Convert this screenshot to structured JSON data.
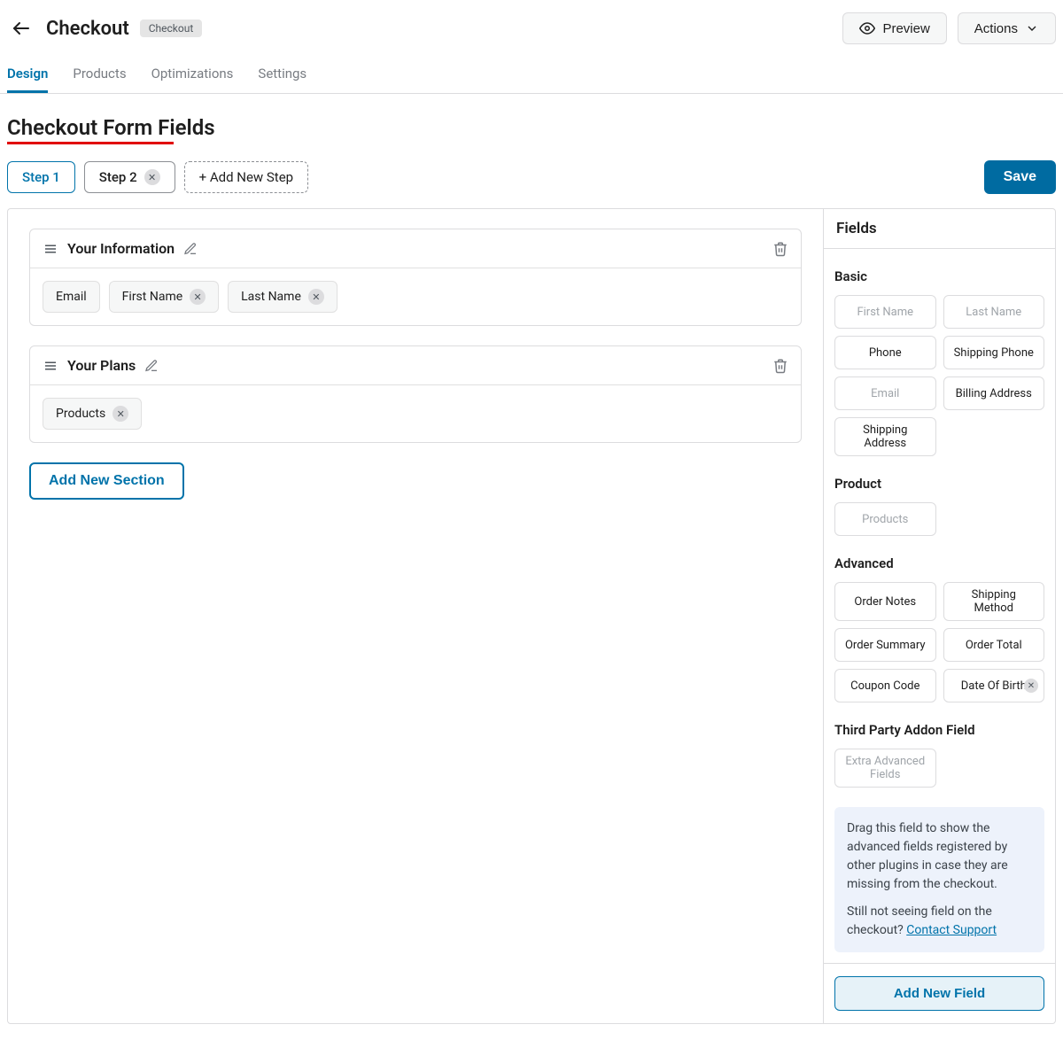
{
  "header": {
    "title": "Checkout",
    "badge": "Checkout",
    "preview": "Preview",
    "actions": "Actions"
  },
  "tabs": [
    "Design",
    "Products",
    "Optimizations",
    "Settings"
  ],
  "page_heading": "Checkout Form Fields",
  "steps": [
    {
      "label": "Step 1",
      "active": true,
      "closable": false
    },
    {
      "label": "Step 2",
      "active": false,
      "closable": true
    }
  ],
  "add_step_label": "+ Add New Step",
  "save_label": "Save",
  "sections": [
    {
      "title": "Your Information",
      "fields": [
        {
          "label": "Email",
          "closable": false
        },
        {
          "label": "First Name",
          "closable": true
        },
        {
          "label": "Last Name",
          "closable": true
        }
      ]
    },
    {
      "title": "Your Plans",
      "fields": [
        {
          "label": "Products",
          "closable": true
        }
      ]
    }
  ],
  "add_section_label": "Add New Section",
  "fields_panel": {
    "heading": "Fields",
    "groups": [
      {
        "title": "Basic",
        "items": [
          {
            "label": "First Name",
            "disabled": true
          },
          {
            "label": "Last Name",
            "disabled": true
          },
          {
            "label": "Phone",
            "disabled": false
          },
          {
            "label": "Shipping Phone",
            "disabled": false
          },
          {
            "label": "Email",
            "disabled": true
          },
          {
            "label": "Billing Address",
            "disabled": false
          },
          {
            "label": "Shipping Address",
            "disabled": false
          }
        ]
      },
      {
        "title": "Product",
        "items": [
          {
            "label": "Products",
            "disabled": true
          }
        ]
      },
      {
        "title": "Advanced",
        "items": [
          {
            "label": "Order Notes",
            "disabled": false
          },
          {
            "label": "Shipping Method",
            "disabled": false
          },
          {
            "label": "Order Summary",
            "disabled": false
          },
          {
            "label": "Order Total",
            "disabled": false
          },
          {
            "label": "Coupon Code",
            "disabled": false
          },
          {
            "label": "Date Of Birth",
            "disabled": false,
            "closable": true
          }
        ]
      },
      {
        "title": "Third Party Addon Field",
        "items": [
          {
            "label": "Extra Advanced Fields",
            "disabled": true
          }
        ]
      }
    ],
    "note_text1": "Drag this field to show the advanced fields registered by other plugins in case they are missing from the checkout.",
    "note_text2": "Still not seeing field on the checkout? ",
    "note_link": "Contact Support",
    "add_field_label": "Add New Field"
  }
}
